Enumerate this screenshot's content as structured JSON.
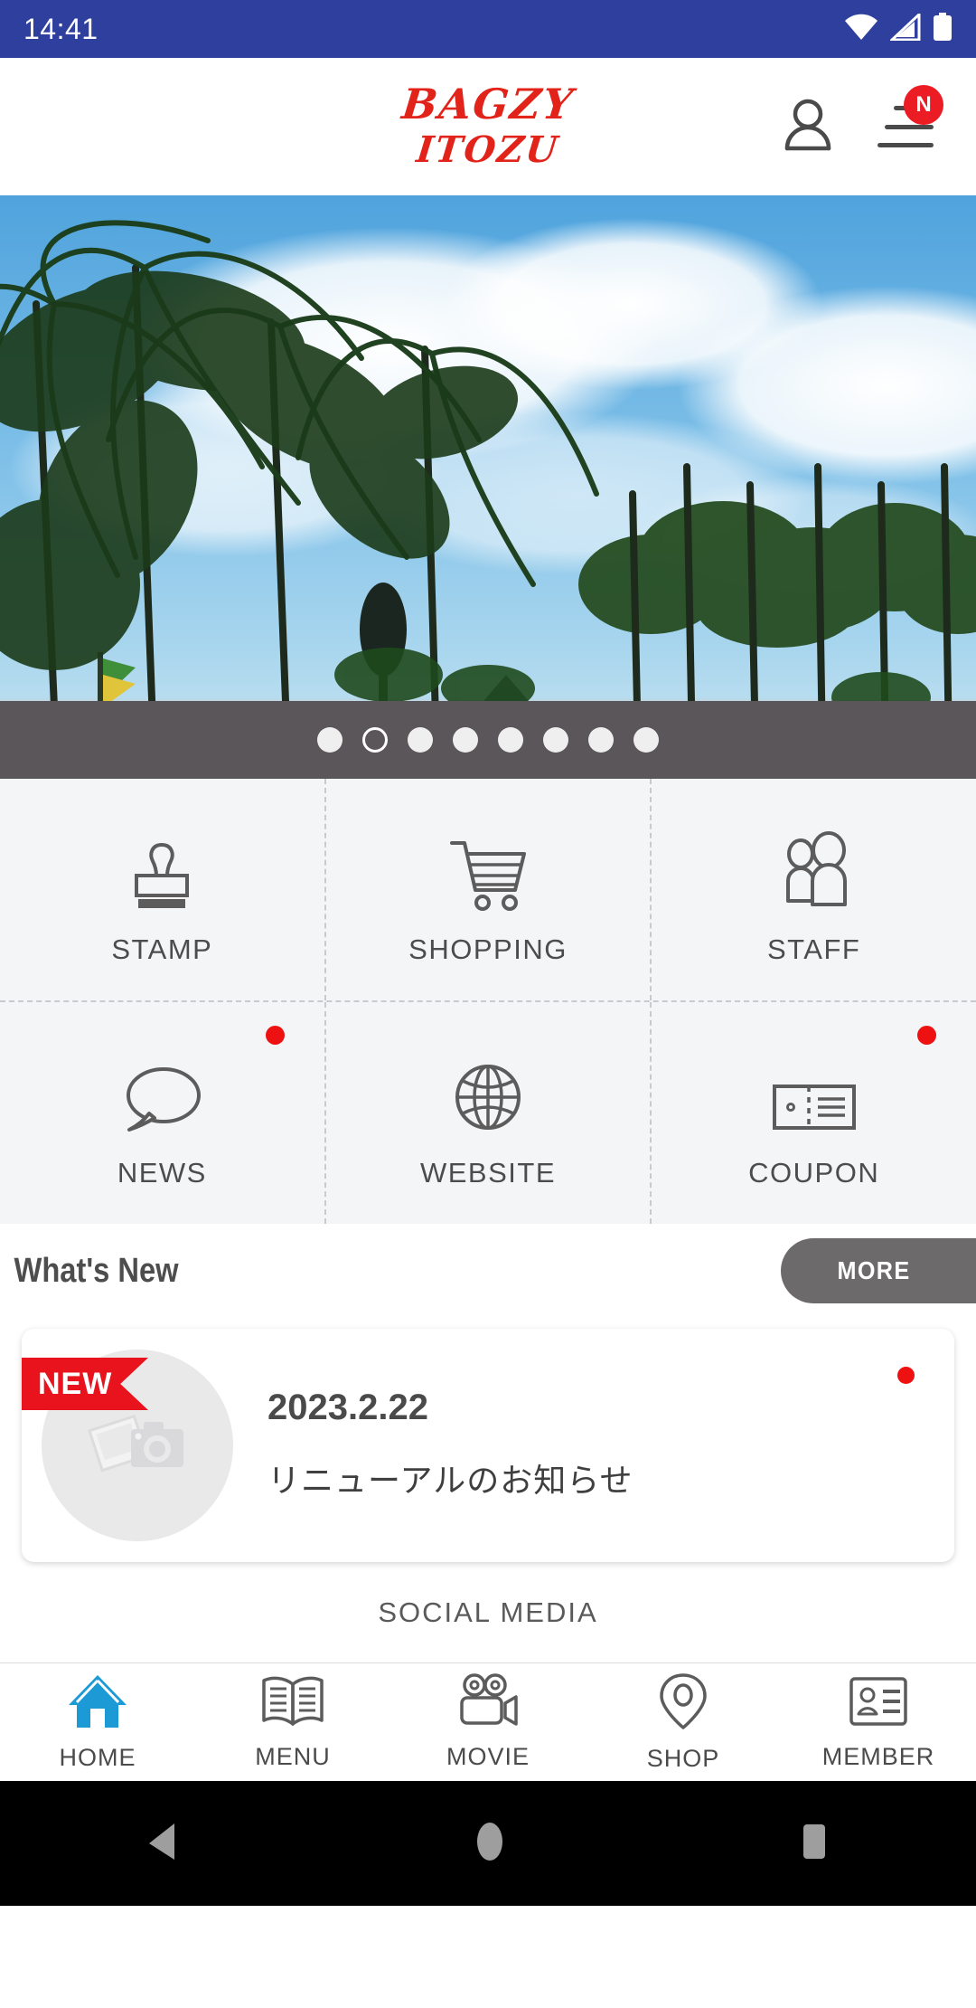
{
  "status_bar": {
    "time": "14:41",
    "icons": [
      "wifi-icon",
      "cellular-signal-icon",
      "battery-icon"
    ],
    "background_color": "#2f3f9e"
  },
  "header": {
    "logo_line1": "BAGZY",
    "logo_line2": "ITOZU",
    "logo_color": "#e2231a",
    "account_icon": "person-icon",
    "menu_icon": "hamburger-menu-icon",
    "menu_badge": "N",
    "menu_badge_color": "#ec1c24"
  },
  "hero": {
    "alt": "Tropical beach with palm trees and blue sky",
    "slide_count": 8,
    "active_slide": 2,
    "dots_background": "#5b5659"
  },
  "grid_menu": {
    "items": [
      {
        "label": "STAMP",
        "icon": "stamp-icon",
        "badge": false
      },
      {
        "label": "SHOPPING",
        "icon": "cart-icon",
        "badge": false
      },
      {
        "label": "STAFF",
        "icon": "people-icon",
        "badge": false
      },
      {
        "label": "NEWS",
        "icon": "chat-bubble-icon",
        "badge": true
      },
      {
        "label": "WEBSITE",
        "icon": "globe-icon",
        "badge": false
      },
      {
        "label": "COUPON",
        "icon": "ticket-icon",
        "badge": true
      }
    ],
    "badge_color": "#ee1111",
    "background_color": "#f4f5f7"
  },
  "whats_new": {
    "title": "What's New",
    "more_label": "MORE",
    "more_color": "#6d6a6c",
    "items": [
      {
        "ribbon": "NEW",
        "date": "2023.2.22",
        "title": "リニューアルのお知らせ",
        "thumbnail": "image-placeholder-icon",
        "unread": true
      }
    ]
  },
  "social": {
    "title": "SOCIAL MEDIA"
  },
  "bottom_nav": {
    "active_index": 0,
    "active_color": "#1c9ad6",
    "items": [
      {
        "label": "HOME",
        "icon": "home-icon"
      },
      {
        "label": "MENU",
        "icon": "book-icon"
      },
      {
        "label": "MOVIE",
        "icon": "video-camera-icon"
      },
      {
        "label": "SHOP",
        "icon": "location-pin-icon"
      },
      {
        "label": "MEMBER",
        "icon": "id-card-icon"
      }
    ]
  },
  "android_nav": {
    "back": "back-triangle-icon",
    "home": "home-circle-icon",
    "recents": "recents-square-icon"
  }
}
